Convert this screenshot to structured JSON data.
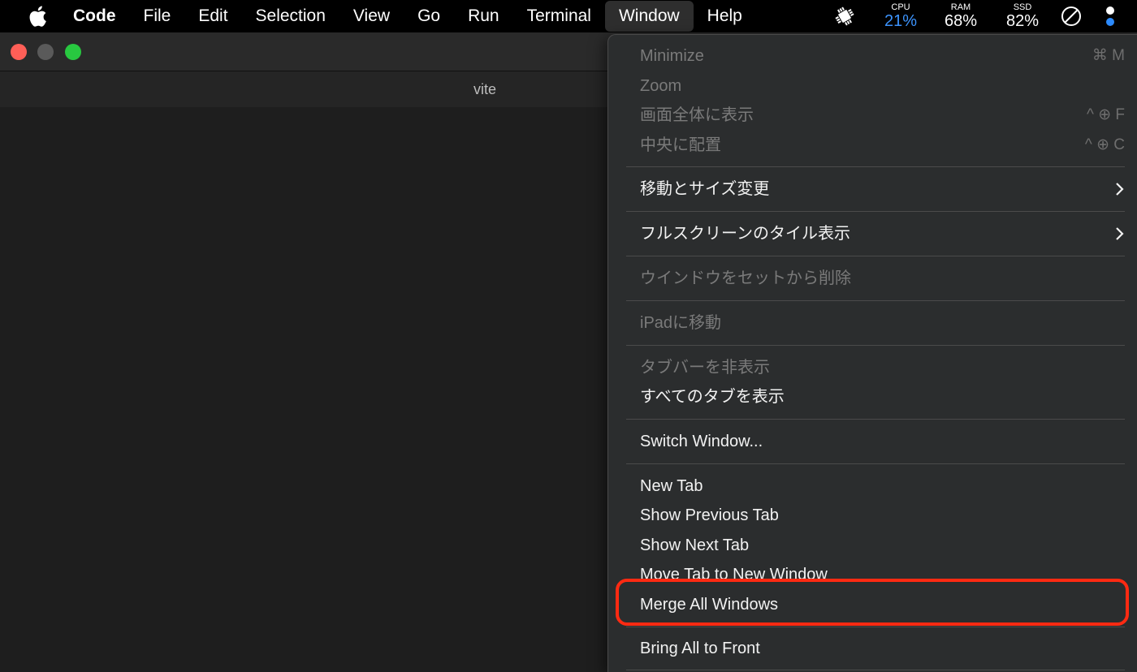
{
  "menubar": {
    "app_name": "Code",
    "items": [
      "File",
      "Edit",
      "Selection",
      "View",
      "Go",
      "Run",
      "Terminal",
      "Window",
      "Help"
    ],
    "active_item": "Window",
    "status": {
      "cpu_label": "CPU",
      "cpu_value": "21%",
      "ram_label": "RAM",
      "ram_value": "68%",
      "ssd_label": "SSD",
      "ssd_value": "82%"
    }
  },
  "window": {
    "tab_title": "vite",
    "traffic_light_colors": {
      "close": "#ff5f57",
      "minimize": "#5a5a5a",
      "zoom": "#28c840"
    }
  },
  "window_menu": {
    "items": [
      {
        "label": "Minimize",
        "shortcut": "⌘ M",
        "disabled": true
      },
      {
        "label": "Zoom",
        "shortcut": "",
        "disabled": true
      },
      {
        "label": "画面全体に表示",
        "shortcut": "^ ⊕ F",
        "disabled": true
      },
      {
        "label": "中央に配置",
        "shortcut": "^ ⊕ C",
        "disabled": true
      },
      {
        "label": "移動とサイズ変更",
        "submenu": true,
        "disabled": false
      },
      {
        "label": "フルスクリーンのタイル表示",
        "submenu": true,
        "disabled": false
      },
      {
        "label": "ウインドウをセットから削除",
        "disabled": true
      },
      {
        "label": "iPadに移動",
        "disabled": true
      },
      {
        "label": "タブバーを非表示",
        "disabled": true
      },
      {
        "label": "すべてのタブを表示",
        "disabled": false
      },
      {
        "label": "Switch Window...",
        "disabled": false
      },
      {
        "label": "New Tab",
        "disabled": false
      },
      {
        "label": "Show Previous Tab",
        "disabled": false
      },
      {
        "label": "Show Next Tab",
        "disabled": false
      },
      {
        "label": "Move Tab to New Window",
        "disabled": false
      },
      {
        "label": "Merge All Windows",
        "disabled": false,
        "highlighted": true
      },
      {
        "label": "Bring All to Front",
        "disabled": false
      }
    ]
  },
  "colors": {
    "highlight_border": "#ff2a12",
    "cpu_accent": "#3d95ff"
  }
}
